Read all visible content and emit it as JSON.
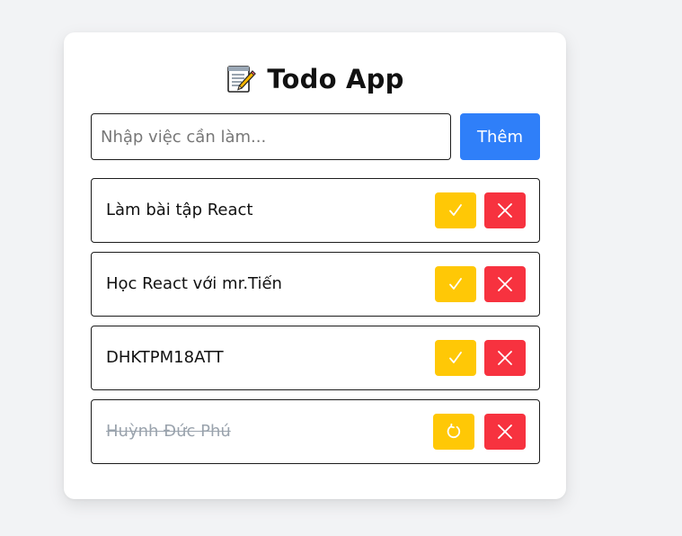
{
  "app": {
    "title": "Todo App",
    "title_icon": "memo-icon"
  },
  "form": {
    "input_value": "",
    "input_placeholder": "Nhập việc cần làm...",
    "add_label": "Thêm"
  },
  "todos": [
    {
      "text": "Làm bài tập React",
      "completed": false,
      "toggle_icon": "check-icon",
      "delete_icon": "close-icon"
    },
    {
      "text": "Học React với mr.Tiến",
      "completed": false,
      "toggle_icon": "check-icon",
      "delete_icon": "close-icon"
    },
    {
      "text": "DHKTPM18ATT",
      "completed": false,
      "toggle_icon": "check-icon",
      "delete_icon": "close-icon"
    },
    {
      "text": "Huỳnh Đức Phú",
      "completed": true,
      "toggle_icon": "undo-icon",
      "delete_icon": "close-icon"
    }
  ],
  "colors": {
    "page_background": "#f2f3f5",
    "card_background": "#ffffff",
    "add_button": "#2f7ff9",
    "toggle_button": "#ffc806",
    "delete_button": "#f7323f",
    "completed_text": "#9aa3ad"
  }
}
